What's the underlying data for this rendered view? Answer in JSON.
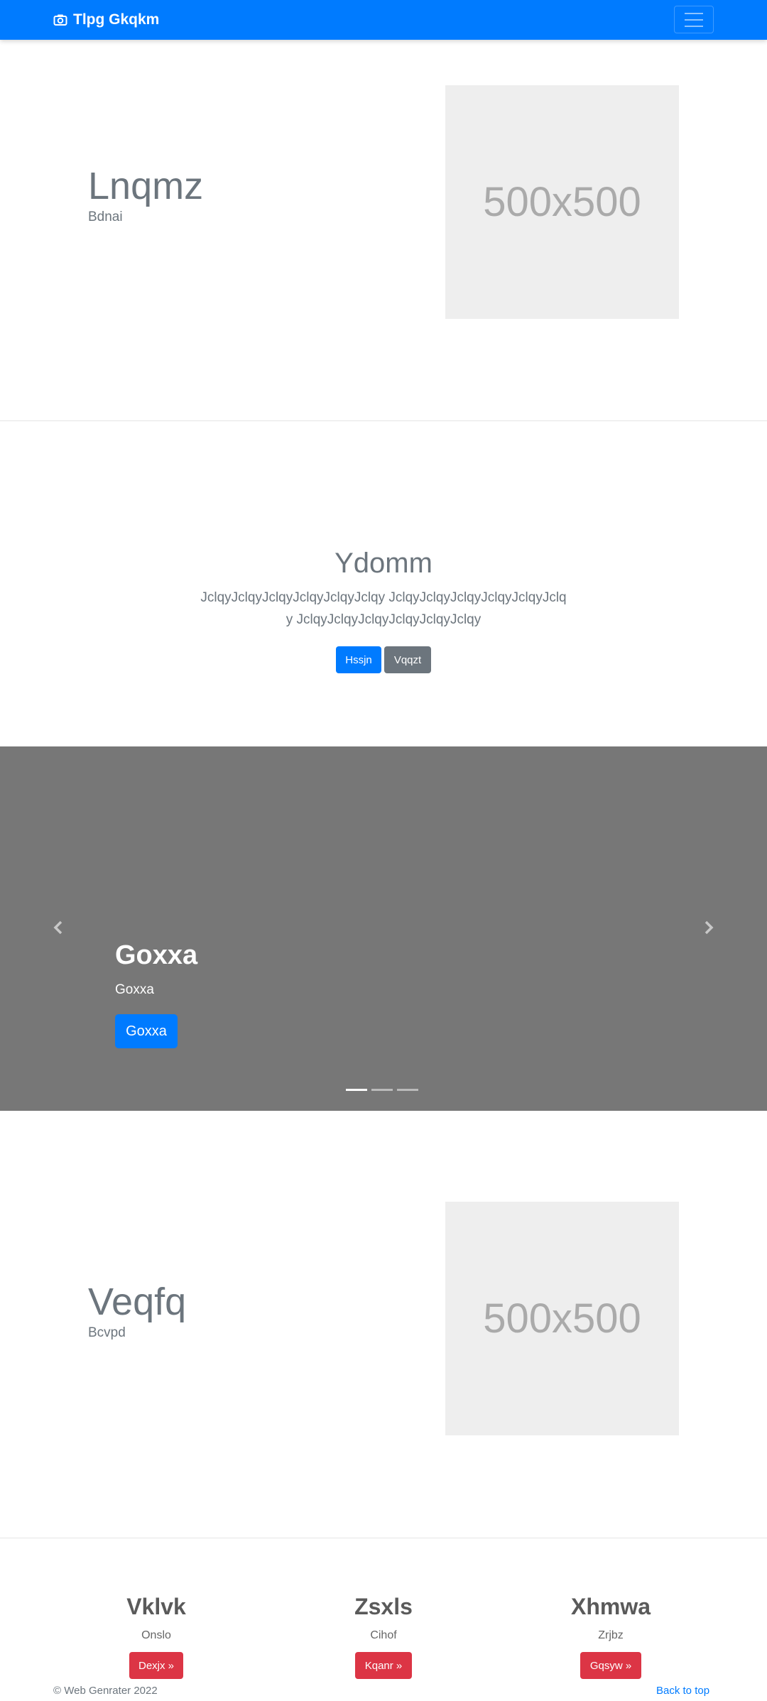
{
  "navbar": {
    "brand": "Tlpg Gkqkm",
    "brand_icon": "camera-icon",
    "toggler_icon": "hamburger-menu-icon",
    "background": "#007bff"
  },
  "feature1": {
    "title": "Lnqmz",
    "subtitle": "Bdnai",
    "image_label": "500x500"
  },
  "jumbotron": {
    "title": "Ydomm",
    "lead": "JclqyJclqyJclqyJclqyJclqyJclqy JclqyJclqyJclqyJclqyJclqyJclqy JclqyJclqyJclqyJclqyJclqyJclqy",
    "primary_button": "Hssjn",
    "secondary_button": "Vqqzt"
  },
  "carousel": {
    "title": "Goxxa",
    "text": "Goxxa",
    "button": "Goxxa",
    "prev_icon": "chevron-left-icon",
    "next_icon": "chevron-right-icon",
    "active_index": 0,
    "indicator_count": 3,
    "background": "#777777"
  },
  "feature2": {
    "title": "Veqfq",
    "subtitle": "Bcvpd",
    "image_label": "500x500"
  },
  "columns": [
    {
      "title": "Vklvk",
      "text": "Onslo",
      "button": "Dexjx »"
    },
    {
      "title": "Zsxls",
      "text": "Cihof",
      "button": "Kqanr »"
    },
    {
      "title": "Xhmwa",
      "text": "Zrjbz",
      "button": "Gqsyw »"
    }
  ],
  "footer": {
    "copyright": "© Web Genrater 2022",
    "back_to_top": "Back to top"
  },
  "colors": {
    "primary": "#007bff",
    "secondary": "#6c757d",
    "danger": "#dc3545"
  }
}
